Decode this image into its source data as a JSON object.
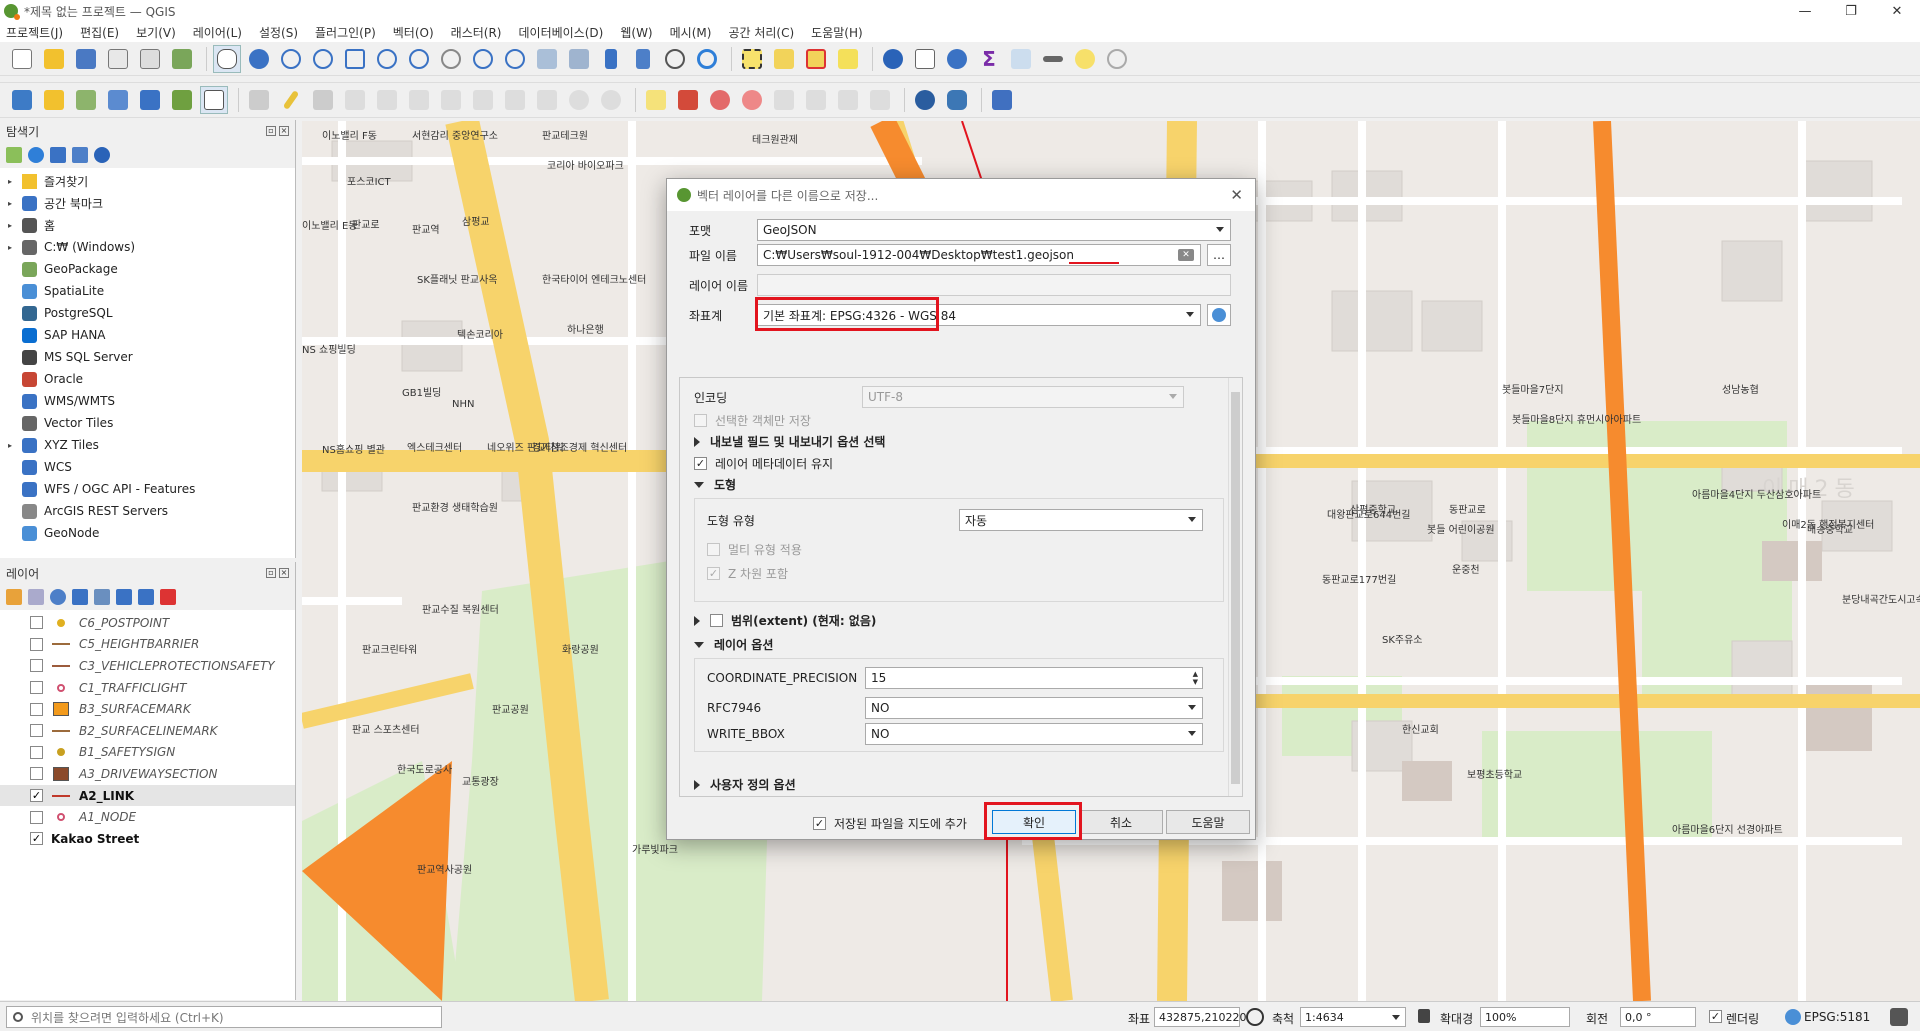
{
  "window": {
    "title": "*제목 없는 프로젝트 — QGIS",
    "controls": [
      "—",
      "❐",
      "✕"
    ]
  },
  "menu": [
    "프로젝트(J)",
    "편집(E)",
    "보기(V)",
    "레이어(L)",
    "설정(S)",
    "플러그인(P)",
    "벡터(O)",
    "래스터(R)",
    "데이터베이스(D)",
    "웹(W)",
    "메시(M)",
    "공간 처리(C)",
    "도움말(H)"
  ],
  "browser": {
    "title": "탐색기",
    "items": [
      {
        "label": "즐겨찾기",
        "icon": "star-icon",
        "arrow": "▸"
      },
      {
        "label": "공간 북마크",
        "icon": "bookmark-icon",
        "arrow": "▸"
      },
      {
        "label": "홈",
        "icon": "home-icon",
        "arrow": "▸"
      },
      {
        "label": "C:₩ (Windows)",
        "icon": "drive-icon",
        "arrow": "▸"
      },
      {
        "label": "GeoPackage",
        "icon": "geopackage-icon",
        "arrow": ""
      },
      {
        "label": "SpatiaLite",
        "icon": "spatialite-icon",
        "arrow": ""
      },
      {
        "label": "PostgreSQL",
        "icon": "postgresql-icon",
        "arrow": ""
      },
      {
        "label": "SAP HANA",
        "icon": "sap-hana-icon",
        "arrow": ""
      },
      {
        "label": "MS SQL Server",
        "icon": "mssql-icon",
        "arrow": ""
      },
      {
        "label": "Oracle",
        "icon": "oracle-icon",
        "arrow": ""
      },
      {
        "label": "WMS/WMTS",
        "icon": "wms-icon",
        "arrow": ""
      },
      {
        "label": "Vector Tiles",
        "icon": "vector-tiles-icon",
        "arrow": ""
      },
      {
        "label": "XYZ Tiles",
        "icon": "xyz-tiles-icon",
        "arrow": "▸"
      },
      {
        "label": "WCS",
        "icon": "wcs-icon",
        "arrow": ""
      },
      {
        "label": "WFS / OGC API - Features",
        "icon": "wfs-icon",
        "arrow": ""
      },
      {
        "label": "ArcGIS REST Servers",
        "icon": "arcgis-icon",
        "arrow": ""
      },
      {
        "label": "GeoNode",
        "icon": "geonode-icon",
        "arrow": ""
      }
    ]
  },
  "layers": {
    "title": "레이어",
    "items": [
      {
        "label": "C6_POSTPOINT",
        "checked": "",
        "symbol": "dot",
        "color": "#e0b020",
        "on": false
      },
      {
        "label": "C5_HEIGHTBARRIER",
        "checked": "",
        "symbol": "line",
        "color": "#9c6b3c",
        "on": false
      },
      {
        "label": "C3_VEHICLEPROTECTIONSAFETY",
        "checked": "",
        "symbol": "line",
        "color": "#9c5b3c",
        "on": false
      },
      {
        "label": "C1_TRAFFICLIGHT",
        "checked": "",
        "symbol": "ring",
        "color": "#d05070",
        "on": false
      },
      {
        "label": "B3_SURFACEMARK",
        "checked": "",
        "symbol": "fill",
        "color": "#f29a1c",
        "on": false
      },
      {
        "label": "B2_SURFACELINEMARK",
        "checked": "",
        "symbol": "line",
        "color": "#9c6b3c",
        "on": false
      },
      {
        "label": "B1_SAFETYSIGN",
        "checked": "",
        "symbol": "dot",
        "color": "#c8a020",
        "on": false
      },
      {
        "label": "A3_DRIVEWAYSECTION",
        "checked": "",
        "symbol": "fill",
        "color": "#8b4a2b",
        "on": false
      },
      {
        "label": "A2_LINK",
        "checked": "✓",
        "symbol": "line",
        "color": "#c0392b",
        "on": true
      },
      {
        "label": "A1_NODE",
        "checked": "",
        "symbol": "ring",
        "color": "#d05070",
        "on": false
      },
      {
        "label": "Kakao Street",
        "checked": "✓",
        "symbol": "none",
        "color": "",
        "on": true
      }
    ]
  },
  "map_labels": [
    "이노밸리 F동",
    "서현감리 중앙연구소",
    "판교테크원",
    "코리아 바이오파크",
    "포스코ICT",
    "이노밸리 E동",
    "판교역",
    "삼평교",
    "SK플래닛 판교사옥",
    "한국타이어 엔테크노센터",
    "하나은행",
    "텍손코리아",
    "GB1빌딩",
    "NHN",
    "NS 쇼핑빌딩",
    "NS홈쇼핑 별관",
    "엑스테크센터",
    "네오위즈 판교타워",
    "경기창조경제 혁신센터",
    "판교환경 생태학습원",
    "판교수질 복원센터",
    "화랑공원",
    "판교크린타워",
    "판교 스포츠센터",
    "한국도로공사",
    "교통광장",
    "판교역사공원",
    "판교공원",
    "가루빛파크",
    "운중천",
    "SK주유소",
    "한신교회",
    "삼평중학교",
    "봇들마을7단지",
    "봇들마을8단지 휴먼시아아파트",
    "봇들 어린이공원",
    "동판교로",
    "분당내곡간도시고속화도로",
    "이매2동",
    "이매2동 행정복지센터",
    "매송중학교",
    "보평초등학교",
    "아름마을6단지 선경아파트",
    "아름마을4단지 두산삼호아파트",
    "성남농협",
    "테크원관제",
    "판교로",
    "대왕판교로644번길",
    "동판교로177번길"
  ],
  "dialog": {
    "title": "벡터 레이어를 다른 이름으로 저장...",
    "format_label": "포맷",
    "format_value": "GeoJSON",
    "file_label": "파일 이름",
    "file_value": "C:₩Users₩soul-1912-004₩Desktop₩test1.geojson",
    "browse_label": "…",
    "layer_label": "레이어 이름",
    "layer_value": "",
    "crs_label": "좌표계",
    "crs_value": "기본 좌표계: EPSG:4326 - WGS 84",
    "encoding_label": "인코딩",
    "encoding_value": "UTF-8",
    "selected_only_label": "선택한 객체만 저장",
    "fields_section": "내보낼 필드 및 내보내기 옵션 선택",
    "persist_meta_label": "레이어 메타데이터 유지",
    "geometry_section": "도형",
    "geometry_type_label": "도형 유형",
    "geometry_type_value": "자동",
    "multi_label": "멀티 유형 적용",
    "z_label": "Z 차원 포함",
    "extent_section": "범위(extent) (현재: 없음)",
    "layer_options_section": "레이어 옵션",
    "options": [
      {
        "name": "COORDINATE_PRECISION",
        "value": "15"
      },
      {
        "name": "RFC7946",
        "value": "NO"
      },
      {
        "name": "WRITE_BBOX",
        "value": "NO"
      }
    ],
    "custom_section": "사용자 정의 옵션",
    "add_to_map_label": "저장된 파일을 지도에 추가",
    "ok_label": "확인",
    "cancel_label": "취소",
    "help_label": "도움말"
  },
  "status": {
    "locator_placeholder": "위치를 찾으려면 입력하세요 (Ctrl+K)",
    "coord_label": "좌표",
    "coord_value": "432875,210220",
    "scale_label": "축척",
    "scale_value": "1:4634",
    "magnifier_label": "확대경",
    "magnifier_value": "100%",
    "rotation_label": "회전",
    "rotation_value": "0,0 °",
    "render_label": "렌더링",
    "crs": "EPSG:5181"
  },
  "colors": {
    "accent_red": "#e2141e",
    "road_yellow": "#f7d36b",
    "highway_orange": "#f68b2e",
    "park_green": "#d9ecc8"
  }
}
